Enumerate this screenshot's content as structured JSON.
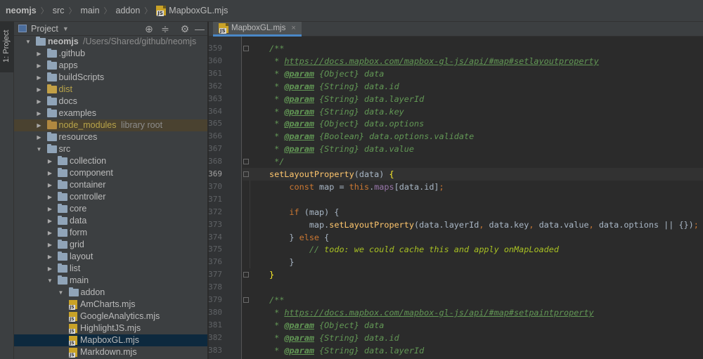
{
  "breadcrumb": {
    "items": [
      "neomjs",
      "src",
      "main",
      "addon"
    ],
    "file": "MapboxGL.mjs"
  },
  "tool_stripe": {
    "project_tab_label": "1: Project"
  },
  "project_panel": {
    "title": "Project",
    "tree": [
      {
        "label": "neomjs",
        "hint": "/Users/Shared/github/neomjs",
        "depth": 0,
        "expanded": true,
        "type": "folder",
        "bold": true
      },
      {
        "label": ".github",
        "depth": 1,
        "expanded": false,
        "type": "folder"
      },
      {
        "label": "apps",
        "depth": 1,
        "expanded": false,
        "type": "folder"
      },
      {
        "label": "buildScripts",
        "depth": 1,
        "expanded": false,
        "type": "folder"
      },
      {
        "label": "dist",
        "depth": 1,
        "expanded": false,
        "type": "folder-yellow",
        "style": "dist"
      },
      {
        "label": "docs",
        "depth": 1,
        "expanded": false,
        "type": "folder"
      },
      {
        "label": "examples",
        "depth": 1,
        "expanded": false,
        "type": "folder"
      },
      {
        "label": "node_modules",
        "hint": "library root",
        "depth": 1,
        "expanded": false,
        "type": "folder-orange",
        "style": "nm",
        "excluded": true
      },
      {
        "label": "resources",
        "depth": 1,
        "expanded": false,
        "type": "folder"
      },
      {
        "label": "src",
        "depth": 1,
        "expanded": true,
        "type": "folder"
      },
      {
        "label": "collection",
        "depth": 2,
        "expanded": false,
        "type": "folder"
      },
      {
        "label": "component",
        "depth": 2,
        "expanded": false,
        "type": "folder"
      },
      {
        "label": "container",
        "depth": 2,
        "expanded": false,
        "type": "folder"
      },
      {
        "label": "controller",
        "depth": 2,
        "expanded": false,
        "type": "folder"
      },
      {
        "label": "core",
        "depth": 2,
        "expanded": false,
        "type": "folder"
      },
      {
        "label": "data",
        "depth": 2,
        "expanded": false,
        "type": "folder"
      },
      {
        "label": "form",
        "depth": 2,
        "expanded": false,
        "type": "folder"
      },
      {
        "label": "grid",
        "depth": 2,
        "expanded": false,
        "type": "folder"
      },
      {
        "label": "layout",
        "depth": 2,
        "expanded": false,
        "type": "folder"
      },
      {
        "label": "list",
        "depth": 2,
        "expanded": false,
        "type": "folder"
      },
      {
        "label": "main",
        "depth": 2,
        "expanded": true,
        "type": "folder"
      },
      {
        "label": "addon",
        "depth": 3,
        "expanded": true,
        "type": "folder"
      },
      {
        "label": "AmCharts.mjs",
        "depth": 4,
        "type": "file"
      },
      {
        "label": "GoogleAnalytics.mjs",
        "depth": 4,
        "type": "file"
      },
      {
        "label": "HighlightJS.mjs",
        "depth": 4,
        "type": "file"
      },
      {
        "label": "MapboxGL.mjs",
        "depth": 4,
        "type": "file",
        "selected": true
      },
      {
        "label": "Markdown.mjs",
        "depth": 4,
        "type": "file"
      }
    ]
  },
  "editor": {
    "tab_label": "MapboxGL.mjs",
    "current_line": 369,
    "lines": [
      {
        "n": 359,
        "tokens": [
          [
            "c-doc",
            "/**"
          ]
        ]
      },
      {
        "n": 360,
        "tokens": [
          [
            "c-doc",
            " * "
          ],
          [
            "c-link",
            "https://docs.mapbox.com/mapbox-gl-js/api/#map#setlayoutproperty"
          ]
        ]
      },
      {
        "n": 361,
        "tokens": [
          [
            "c-doc",
            " * "
          ],
          [
            "c-tag",
            "@param"
          ],
          [
            "c-type",
            " {Object} data"
          ]
        ]
      },
      {
        "n": 362,
        "tokens": [
          [
            "c-doc",
            " * "
          ],
          [
            "c-tag",
            "@param"
          ],
          [
            "c-type",
            " {String} data.id"
          ]
        ]
      },
      {
        "n": 363,
        "tokens": [
          [
            "c-doc",
            " * "
          ],
          [
            "c-tag",
            "@param"
          ],
          [
            "c-type",
            " {String} data.layerId"
          ]
        ]
      },
      {
        "n": 364,
        "tokens": [
          [
            "c-doc",
            " * "
          ],
          [
            "c-tag",
            "@param"
          ],
          [
            "c-type",
            " {String} data.key"
          ]
        ]
      },
      {
        "n": 365,
        "tokens": [
          [
            "c-doc",
            " * "
          ],
          [
            "c-tag",
            "@param"
          ],
          [
            "c-type",
            " {Object} data.options"
          ]
        ]
      },
      {
        "n": 366,
        "tokens": [
          [
            "c-doc",
            " * "
          ],
          [
            "c-tag",
            "@param"
          ],
          [
            "c-type",
            " {Boolean} data.options.validate"
          ]
        ]
      },
      {
        "n": 367,
        "tokens": [
          [
            "c-doc",
            " * "
          ],
          [
            "c-tag",
            "@param"
          ],
          [
            "c-type",
            " {String} data.value"
          ]
        ]
      },
      {
        "n": 368,
        "tokens": [
          [
            "c-doc",
            " */"
          ]
        ]
      },
      {
        "n": 369,
        "tokens": [
          [
            "c-name",
            "setLayoutProperty"
          ],
          [
            "c-plain",
            "(data) "
          ],
          [
            "c-brace",
            "{"
          ]
        ]
      },
      {
        "n": 370,
        "tokens": [
          [
            "c-plain",
            "    "
          ],
          [
            "c-kw",
            "const"
          ],
          [
            "c-plain",
            " map = "
          ],
          [
            "c-kw",
            "this"
          ],
          [
            "c-plain",
            "."
          ],
          [
            "c-prop",
            "maps"
          ],
          [
            "c-plain",
            "[data.id]"
          ],
          [
            "c-kw",
            ";"
          ]
        ]
      },
      {
        "n": 371,
        "tokens": []
      },
      {
        "n": 372,
        "tokens": [
          [
            "c-plain",
            "    "
          ],
          [
            "c-kw",
            "if"
          ],
          [
            "c-plain",
            " (map) {"
          ]
        ]
      },
      {
        "n": 373,
        "tokens": [
          [
            "c-plain",
            "        map."
          ],
          [
            "c-name",
            "setLayoutProperty"
          ],
          [
            "c-plain",
            "(data.layerId"
          ],
          [
            "c-kw",
            ","
          ],
          [
            "c-plain",
            " data.key"
          ],
          [
            "c-kw",
            ","
          ],
          [
            "c-plain",
            " data.value"
          ],
          [
            "c-kw",
            ","
          ],
          [
            "c-plain",
            " data.options || {})"
          ],
          [
            "c-kw",
            ";"
          ]
        ]
      },
      {
        "n": 374,
        "tokens": [
          [
            "c-plain",
            "    } "
          ],
          [
            "c-kw",
            "else"
          ],
          [
            "c-plain",
            " {"
          ]
        ]
      },
      {
        "n": 375,
        "tokens": [
          [
            "c-plain",
            "        "
          ],
          [
            "c-doc",
            "// "
          ],
          [
            "c-todo",
            "todo: we could cache this and apply onMapLoaded"
          ]
        ]
      },
      {
        "n": 376,
        "tokens": [
          [
            "c-plain",
            "    }"
          ]
        ]
      },
      {
        "n": 377,
        "tokens": [
          [
            "c-brace",
            "}"
          ]
        ]
      },
      {
        "n": 378,
        "tokens": []
      },
      {
        "n": 379,
        "tokens": [
          [
            "c-doc",
            "/**"
          ]
        ]
      },
      {
        "n": 380,
        "tokens": [
          [
            "c-doc",
            " * "
          ],
          [
            "c-link",
            "https://docs.mapbox.com/mapbox-gl-js/api/#map#setpaintproperty"
          ]
        ]
      },
      {
        "n": 381,
        "tokens": [
          [
            "c-doc",
            " * "
          ],
          [
            "c-tag",
            "@param"
          ],
          [
            "c-type",
            " {Object} data"
          ]
        ]
      },
      {
        "n": 382,
        "tokens": [
          [
            "c-doc",
            " * "
          ],
          [
            "c-tag",
            "@param"
          ],
          [
            "c-type",
            " {String} data.id"
          ]
        ]
      },
      {
        "n": 383,
        "tokens": [
          [
            "c-doc",
            " * "
          ],
          [
            "c-tag",
            "@param"
          ],
          [
            "c-type",
            " {String} data.layerId"
          ]
        ]
      }
    ]
  }
}
